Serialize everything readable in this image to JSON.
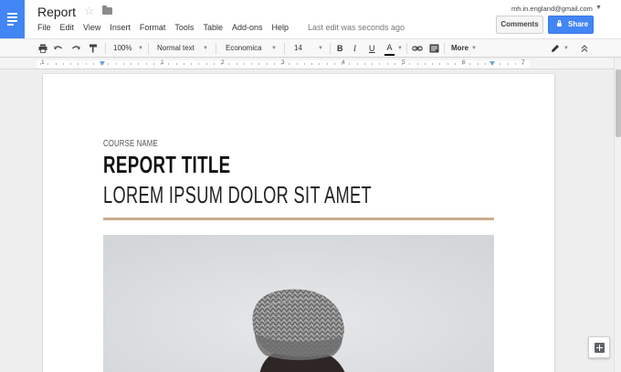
{
  "app": {
    "doc_title": "Report",
    "last_edit": "Last edit was seconds ago",
    "user_email": "mh.in.england@gmail.com"
  },
  "menubar": {
    "items": [
      "File",
      "Edit",
      "View",
      "Insert",
      "Format",
      "Tools",
      "Table",
      "Add-ons",
      "Help"
    ]
  },
  "header_buttons": {
    "comments_label": "Comments",
    "share_label": "Share"
  },
  "toolbar": {
    "zoom": "100%",
    "style": "Normal text",
    "font": "Economica",
    "size": "14",
    "bold_label": "B",
    "italic_label": "I",
    "underline_label": "U",
    "text_color_label": "A",
    "more_label": "More"
  },
  "ruler": {
    "numbers": [
      "1",
      "1",
      "2",
      "3",
      "4",
      "5",
      "6",
      "7"
    ]
  },
  "document": {
    "course_name": "COURSE NAME",
    "report_title": "REPORT TITLE",
    "subtitle": "LOREM IPSUM DOLOR SIT AMET",
    "accent_color": "#c9ad8c"
  },
  "colors": {
    "brand_blue": "#4285f4",
    "share_blue": "#4285f4"
  }
}
